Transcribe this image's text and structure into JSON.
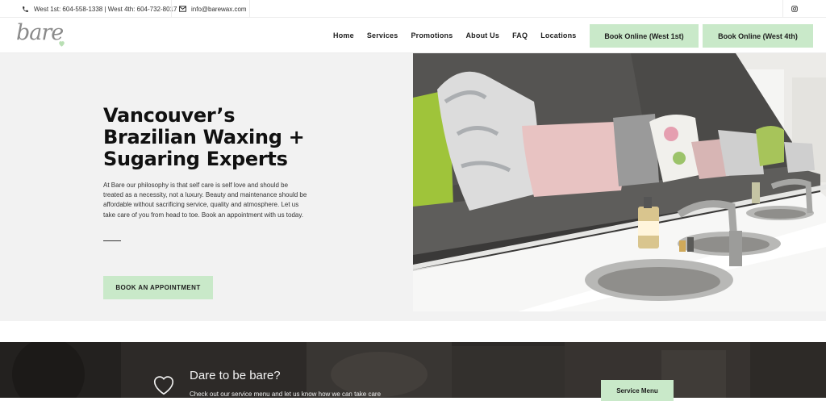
{
  "topbar": {
    "phones": "West 1st: 604-558-1338 | West 4th: 604-732-8017",
    "email": "info@barewax.com",
    "icons": {
      "phone": "phone-icon",
      "email": "envelope-icon",
      "social": "instagram-icon"
    }
  },
  "header": {
    "logo_text": "bare",
    "nav": [
      "Home",
      "Services",
      "Promotions",
      "About Us",
      "FAQ",
      "Locations"
    ],
    "book_west1": "Book Online (West 1st)",
    "book_west4": "Book Online (West 4th)"
  },
  "hero": {
    "title": "Vancouver’s Brazilian Waxing + Sugaring Experts",
    "description": "At Bare our philosophy is that self care is self love and should be treated as a necessity, not a luxury. Beauty and maintenance should be affordable without sacrificing service, quality and atmosphere. Let us take care of you from head to toe. Book an appointment with us today.",
    "cta": "BOOK AN APPOINTMENT",
    "image_alt": "salon-interior-photo"
  },
  "band": {
    "title": "Dare to be bare?",
    "subtitle": "Check out our service menu and let us know how we can take care",
    "button": "Service Menu"
  },
  "colors": {
    "accent": "#c9e9c9",
    "hero_bg": "#f2f2f2",
    "band_bg": "#3e3a37",
    "text_dark": "#111111"
  }
}
